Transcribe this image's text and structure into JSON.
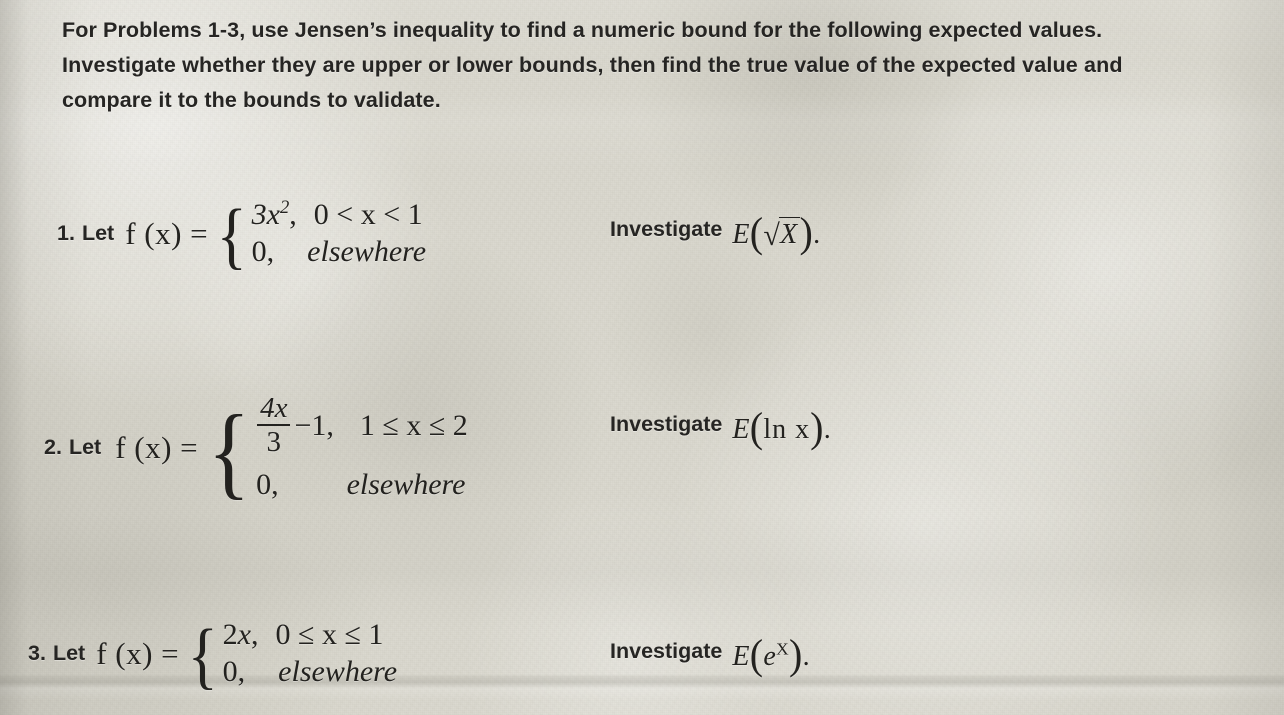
{
  "document": {
    "type": "handout-photo",
    "paper_color": "#d9d7cd",
    "ink_color": "#262523"
  },
  "intro": {
    "line1": "For Problems 1-3, use Jensen’s inequality to find a numeric bound for the following expected values.",
    "line2": "Investigate whether they are upper or lower bounds, then find the true value of the expected value and",
    "line3": "compare it to the bounds to validate."
  },
  "problems": [
    {
      "number": "1.",
      "let_label": "Let",
      "function_name": "f (x) =",
      "cases": [
        {
          "value_main": "3x",
          "value_sup": "2",
          "comma": ",",
          "condition": "0 < x < 1"
        },
        {
          "value_main": "0",
          "comma": ",",
          "condition": "elsewhere"
        }
      ],
      "investigate_label": "Investigate",
      "investigate_expr": {
        "operator": "E",
        "open_paren": "(",
        "radical_sign": "√",
        "argument": "X",
        "close_paren": ")",
        "period": "."
      }
    },
    {
      "number": "2.",
      "let_label": "Let",
      "function_name": "f (x) =",
      "cases": [
        {
          "fraction_numerator": "4x",
          "fraction_denominator": "3",
          "tail": "−1,",
          "condition": "1 ≤ x ≤ 2"
        },
        {
          "value_main": "0",
          "comma": ",",
          "condition": "elsewhere"
        }
      ],
      "investigate_label": "Investigate",
      "investigate_expr": {
        "operator": "E",
        "open_paren": "(",
        "argument": "ln x",
        "close_paren": ")",
        "period": "."
      }
    },
    {
      "number": "3.",
      "let_label": "Let",
      "function_name": "f (x) =",
      "cases": [
        {
          "value_main": "2x",
          "comma": ",",
          "condition": "0 ≤ x ≤ 1"
        },
        {
          "value_main": "0",
          "comma": ",",
          "condition": "elsewhere"
        }
      ],
      "investigate_label": "Investigate",
      "investigate_expr": {
        "operator": "E",
        "open_paren": "(",
        "base": "e",
        "exponent": "X",
        "close_paren": ")",
        "period": "."
      }
    }
  ],
  "glyphs": {
    "brace_left": "{"
  }
}
